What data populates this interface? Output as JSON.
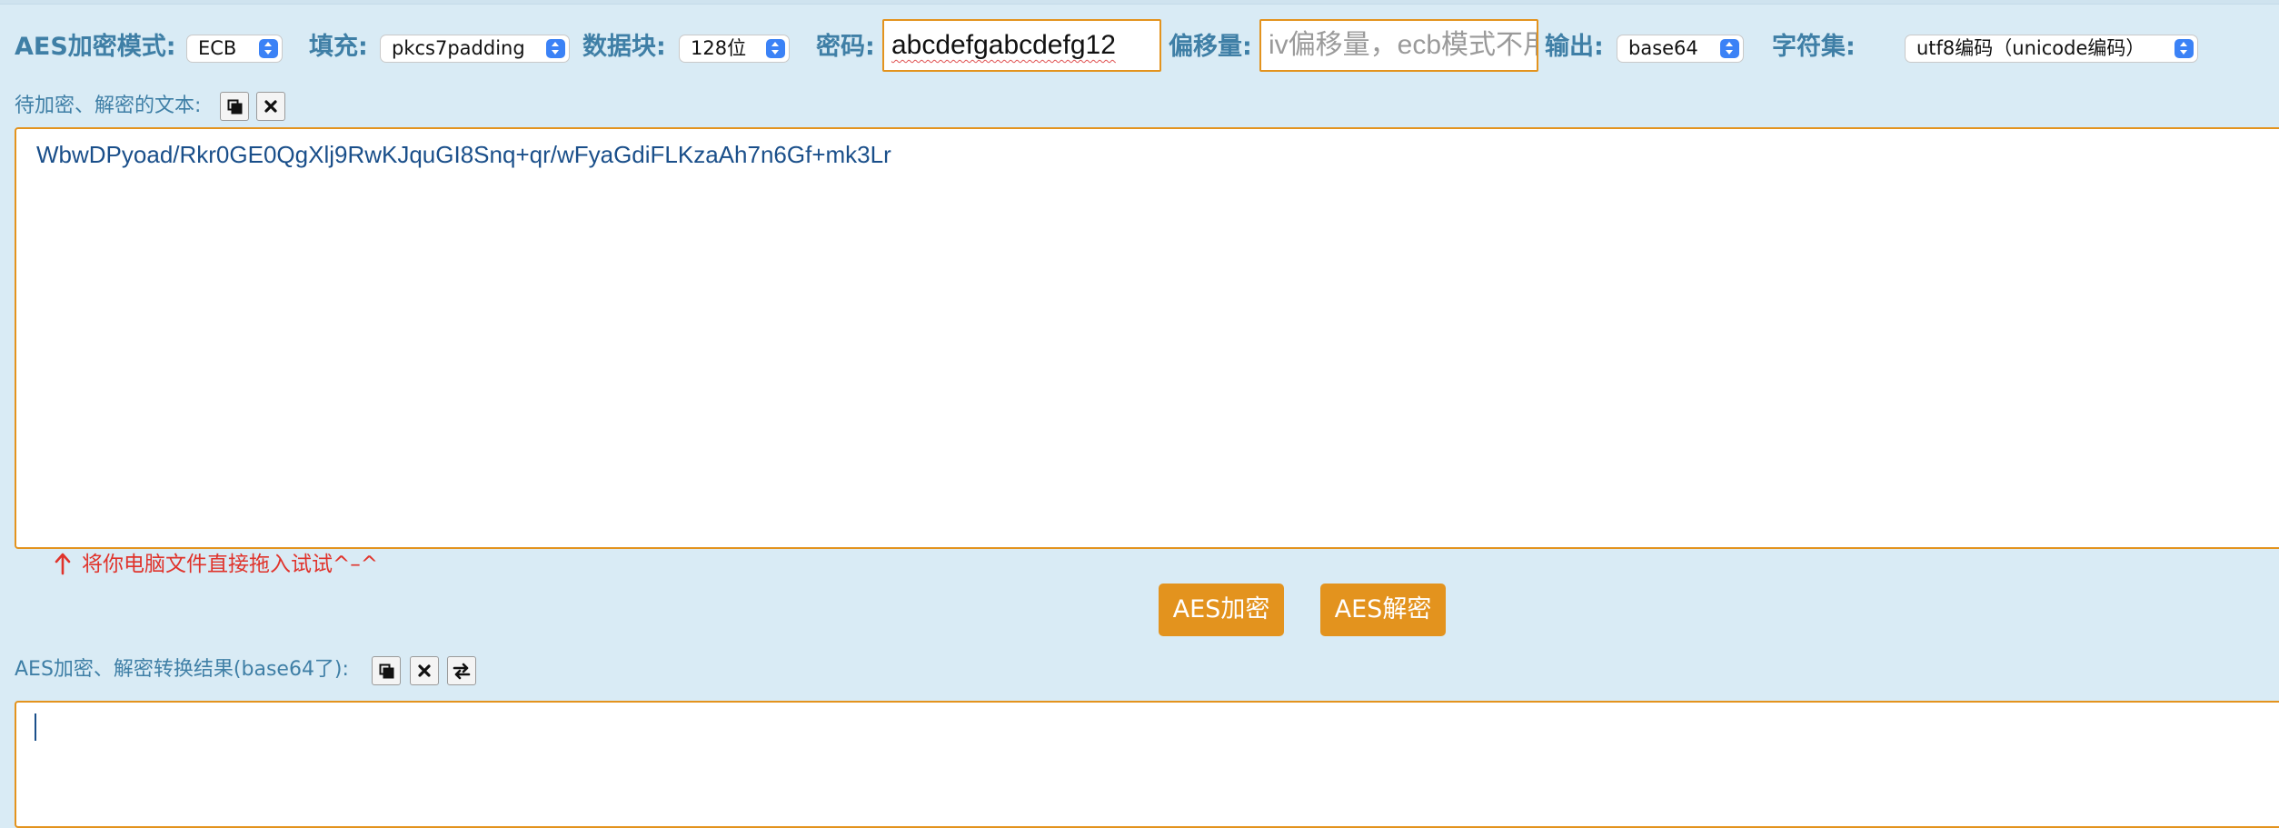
{
  "options": {
    "mode": {
      "label": "AES加密模式:",
      "value": "ECB"
    },
    "padding": {
      "label": "填充:",
      "value": "pkcs7padding"
    },
    "block": {
      "label": "数据块:",
      "value": "128位"
    },
    "password": {
      "label": "密码:",
      "value": "abcdefgabcdefg12"
    },
    "offset": {
      "label": "偏移量:",
      "placeholder": "iv偏移量，ecb模式不用填写"
    },
    "output": {
      "label": "输出:",
      "value": "base64"
    },
    "charset": {
      "label": "字符集:",
      "value": "utf8编码（unicode编码）"
    }
  },
  "input_section": {
    "label": "待加密、解密的文本:",
    "text": "WbwDPyoad/Rkr0GE0QgXlj9RwKJquGI8Snq+qr/wFyaGdiFLKzaAh7n6Gf+mk3Lr",
    "hint": "将你电脑文件直接拖入试试^–^"
  },
  "actions": {
    "encrypt": "AES加密",
    "decrypt": "AES解密"
  },
  "result_section": {
    "label": "AES加密、解密转换结果(base64了):",
    "text": ""
  },
  "icons": {
    "copy": "copy-icon",
    "clear": "close-icon",
    "swap": "swap-icon",
    "select_arrows": "chevron-updown-icon",
    "hint_arrow": "arrow-up-icon"
  },
  "colors": {
    "background": "#d9ebf5",
    "label": "#3f7fa6",
    "accent": "#e3931e",
    "hint": "#e0332b",
    "text": "#1a4f8a",
    "select_arrows": "#3b82f6"
  }
}
